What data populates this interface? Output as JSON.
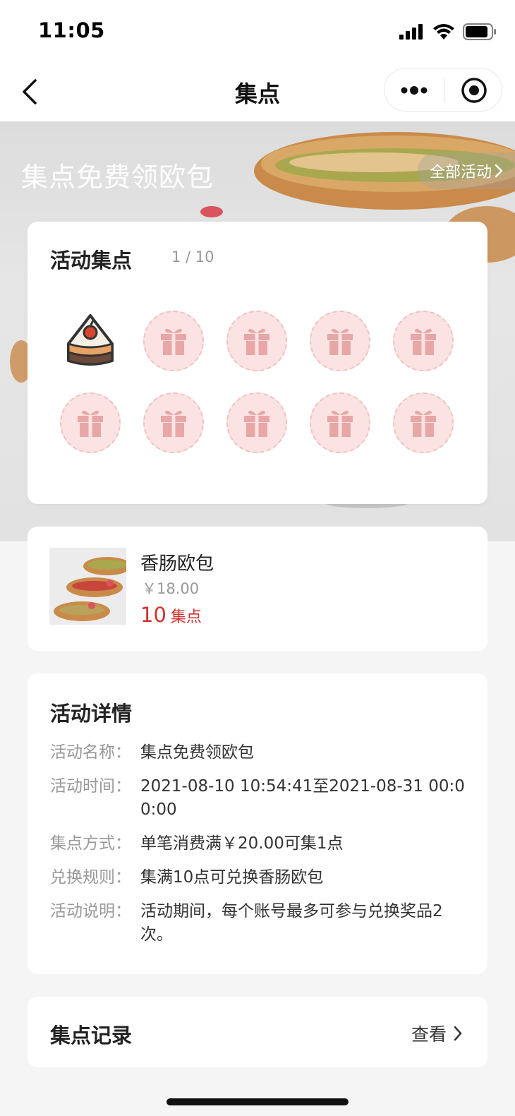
{
  "status_bar": {
    "time": "11:05",
    "icons": [
      "signal-icon",
      "wifi-icon",
      "battery-icon"
    ]
  },
  "nav": {
    "title": "集点",
    "back_icon": "chevron-left-icon",
    "more_icon": "more-dots-icon",
    "close_icon": "target-circle-icon"
  },
  "banner": {
    "title": "集点免费领欧包",
    "all_activities_label": "全部活动"
  },
  "stamp_card": {
    "title": "活动集点",
    "count_text": "1 / 10",
    "collected": 1,
    "total": 10,
    "stamps": [
      {
        "state": "collected",
        "icon": "cake-icon"
      },
      {
        "state": "empty",
        "icon": "gift-icon"
      },
      {
        "state": "empty",
        "icon": "gift-icon"
      },
      {
        "state": "empty",
        "icon": "gift-icon"
      },
      {
        "state": "empty",
        "icon": "gift-icon"
      },
      {
        "state": "empty",
        "icon": "gift-icon"
      },
      {
        "state": "empty",
        "icon": "gift-icon"
      },
      {
        "state": "empty",
        "icon": "gift-icon"
      },
      {
        "state": "empty",
        "icon": "gift-icon"
      },
      {
        "state": "empty",
        "icon": "gift-icon"
      }
    ]
  },
  "product": {
    "name": "香肠欧包",
    "price": "￥18.00",
    "points_num": "10",
    "points_unit": "集点"
  },
  "details": {
    "title": "活动详情",
    "rows": [
      {
        "key": "活动名称：",
        "value": "集点免费领欧包"
      },
      {
        "key": "活动时间：",
        "value": "2021-08-10 10:54:41至2021-08-31 00:00:00"
      },
      {
        "key": "集点方式：",
        "value": "单笔消费满￥20.00可集1点"
      },
      {
        "key": "兑换规则：",
        "value": "集满10点可兑换香肠欧包"
      },
      {
        "key": "活动说明：",
        "value": "活动期间，每个账号最多可参与兑换奖品2次。"
      }
    ]
  },
  "record": {
    "title": "集点记录",
    "view_label": "查看"
  },
  "colors": {
    "accent_red": "#d0312d",
    "stamp_pink": "#fbe3e3",
    "gift_pink": "#e8a7a7"
  }
}
